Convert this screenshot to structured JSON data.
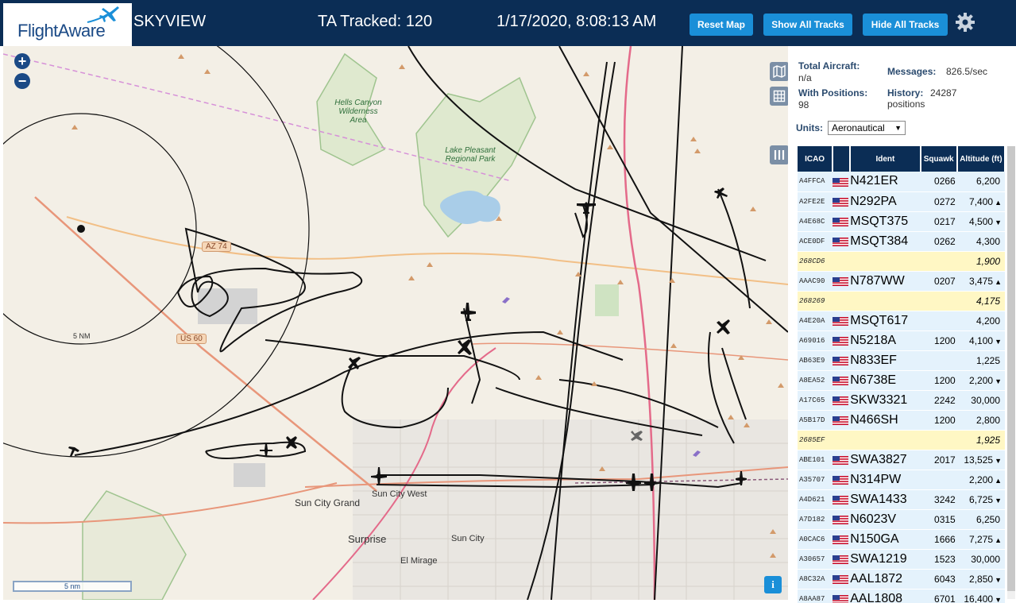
{
  "header": {
    "logo_text": "FlightAware",
    "title": "SKYVIEW",
    "tracked": "TA Tracked: 120",
    "datetime": "1/17/2020, 8:08:13 AM",
    "buttons": {
      "reset": "Reset Map",
      "show": "Show All Tracks",
      "hide": "Hide All Tracks"
    },
    "accent": "#1a8fd8",
    "bar_color": "#0b2d55"
  },
  "map": {
    "zoom_in": "+",
    "zoom_out": "−",
    "scale_label": "5 nm",
    "range_label": "5 NM",
    "info": "i",
    "places": {
      "hells_canyon": "Hells Canyon Wilderness Area",
      "lake_pleasant": "Lake Pleasant Regional Park",
      "sun_city_grand": "Sun City Grand",
      "sun_city_west": "Sun City West",
      "surprise": "Surprise",
      "sun_city": "Sun City",
      "el_mirage": "El Mirage"
    },
    "shields": {
      "az74": "AZ 74",
      "us60": "US 60"
    }
  },
  "stats": {
    "total_aircraft_label": "Total Aircraft:",
    "total_aircraft_value": "n/a",
    "with_positions_label": "With Positions:",
    "with_positions_value": "98",
    "messages_label": "Messages:",
    "messages_value": "826.5/sec",
    "history_label": "History:",
    "history_value": "24287 positions",
    "units_label": "Units:",
    "units_value": "Aeronautical"
  },
  "table": {
    "headers": [
      "ICAO",
      "",
      "Ident",
      "Squawk",
      "Altitude (ft)"
    ],
    "rows": [
      {
        "icao": "A4FFCA",
        "ident": "N421ER",
        "squawk": "0266",
        "alt": "6,200",
        "trend": "",
        "pos": true
      },
      {
        "icao": "A2FE2E",
        "ident": "N292PA",
        "squawk": "0272",
        "alt": "7,400",
        "trend": "▲",
        "pos": true
      },
      {
        "icao": "A4E68C",
        "ident": "MSQT375",
        "squawk": "0217",
        "alt": "4,500",
        "trend": "▼",
        "pos": true
      },
      {
        "icao": "ACE0DF",
        "ident": "MSQT384",
        "squawk": "0262",
        "alt": "4,300",
        "trend": "",
        "pos": true
      },
      {
        "icao": "268CD6",
        "ident": "",
        "squawk": "",
        "alt": "1,900",
        "trend": "",
        "pos": false
      },
      {
        "icao": "AAAC90",
        "ident": "N787WW",
        "squawk": "0207",
        "alt": "3,475",
        "trend": "▲",
        "pos": true
      },
      {
        "icao": "268269",
        "ident": "",
        "squawk": "",
        "alt": "4,175",
        "trend": "",
        "pos": false
      },
      {
        "icao": "A4E20A",
        "ident": "MSQT617",
        "squawk": "",
        "alt": "4,200",
        "trend": "",
        "pos": true
      },
      {
        "icao": "A69016",
        "ident": "N5218A",
        "squawk": "1200",
        "alt": "4,100",
        "trend": "▼",
        "pos": true
      },
      {
        "icao": "AB63E9",
        "ident": "N833EF",
        "squawk": "",
        "alt": "1,225",
        "trend": "",
        "pos": true
      },
      {
        "icao": "A8EA52",
        "ident": "N6738E",
        "squawk": "1200",
        "alt": "2,200",
        "trend": "▼",
        "pos": true
      },
      {
        "icao": "A17C65",
        "ident": "SKW3321",
        "squawk": "2242",
        "alt": "30,000",
        "trend": "",
        "pos": true
      },
      {
        "icao": "A5B17D",
        "ident": "N466SH",
        "squawk": "1200",
        "alt": "2,800",
        "trend": "",
        "pos": true
      },
      {
        "icao": "2685EF",
        "ident": "",
        "squawk": "",
        "alt": "1,925",
        "trend": "",
        "pos": false
      },
      {
        "icao": "ABE101",
        "ident": "SWA3827",
        "squawk": "2017",
        "alt": "13,525",
        "trend": "▼",
        "pos": true
      },
      {
        "icao": "A35707",
        "ident": "N314PW",
        "squawk": "",
        "alt": "2,200",
        "trend": "▲",
        "pos": true
      },
      {
        "icao": "A4D621",
        "ident": "SWA1433",
        "squawk": "3242",
        "alt": "6,725",
        "trend": "▼",
        "pos": true
      },
      {
        "icao": "A7D182",
        "ident": "N6023V",
        "squawk": "0315",
        "alt": "6,250",
        "trend": "",
        "pos": true
      },
      {
        "icao": "A0CAC6",
        "ident": "N150GA",
        "squawk": "1666",
        "alt": "7,275",
        "trend": "▲",
        "pos": true
      },
      {
        "icao": "A30657",
        "ident": "SWA1219",
        "squawk": "1523",
        "alt": "30,000",
        "trend": "",
        "pos": true
      },
      {
        "icao": "A8C32A",
        "ident": "AAL1872",
        "squawk": "6043",
        "alt": "2,850",
        "trend": "▼",
        "pos": true
      },
      {
        "icao": "A8AA87",
        "ident": "AAL1808",
        "squawk": "6701",
        "alt": "16,400",
        "trend": "▼",
        "pos": true
      }
    ]
  }
}
